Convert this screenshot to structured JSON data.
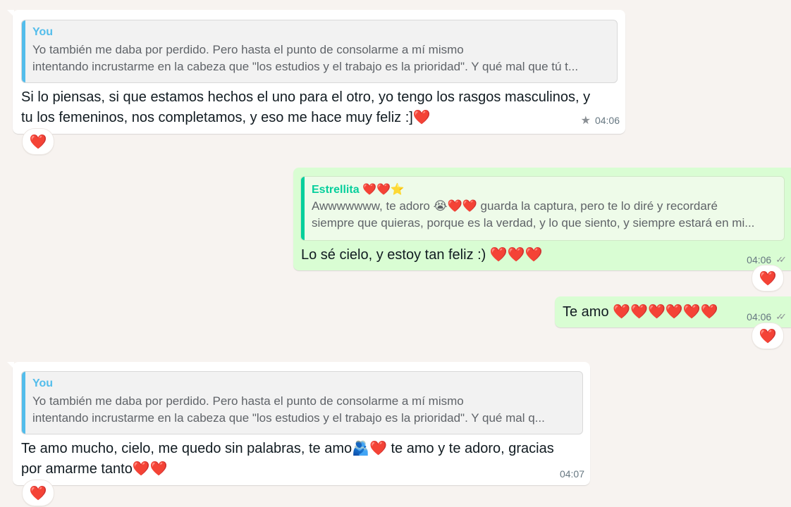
{
  "colors": {
    "background": "#f7f3f0",
    "incoming_bubble": "#ffffff",
    "outgoing_bubble": "#d9fdd3",
    "quote_you": "#53bdeb",
    "quote_estrellita": "#06cf9c",
    "heart": "#e8112d"
  },
  "messages": [
    {
      "quote_author": "You",
      "quote_line1": "Yo también me daba por perdido. Pero hasta el punto de consolarme a mí mismo",
      "quote_line2": "intentando incrustarme en la cabeza que \"los estudios y el trabajo es la prioridad\". Y qué mal que tú t...",
      "text_line1": "Si lo piensas, si que estamos hechos el uno para el otro, yo tengo los rasgos masculinos, y",
      "text_line2": "tu los femeninos, nos completamos, y eso me hace muy feliz :]❤️",
      "time": "04:06",
      "starred": true,
      "reaction": "❤️"
    },
    {
      "quote_author": "Estrellita ❤️❤️⭐",
      "quote_line1": "Awwwwwww, te adoro 😭❤️❤️ guarda la captura, pero te lo diré y recordaré",
      "quote_line2": "siempre que quieras, porque es la verdad, y lo que siento, y siempre estará en mi...",
      "text": "Lo sé cielo, y estoy tan feliz :) ❤️❤️❤️",
      "time": "04:06",
      "reaction": "❤️"
    },
    {
      "text": "Te amo ❤️❤️❤️❤️❤️❤️",
      "time": "04:06",
      "reaction": "❤️"
    },
    {
      "quote_author": "You",
      "quote_line1": "Yo también me daba por perdido. Pero hasta el punto de consolarme a mí mismo",
      "quote_line2": "intentando incrustarme en la cabeza que \"los estudios y el trabajo es la prioridad\". Y qué mal q...",
      "text_line1": "Te amo mucho, cielo, me quedo sin palabras, te amo🫂❤️ te amo y te adoro, gracias",
      "text_line2": "por amarme tanto❤️❤️",
      "time": "04:07",
      "reaction": "❤️"
    }
  ]
}
